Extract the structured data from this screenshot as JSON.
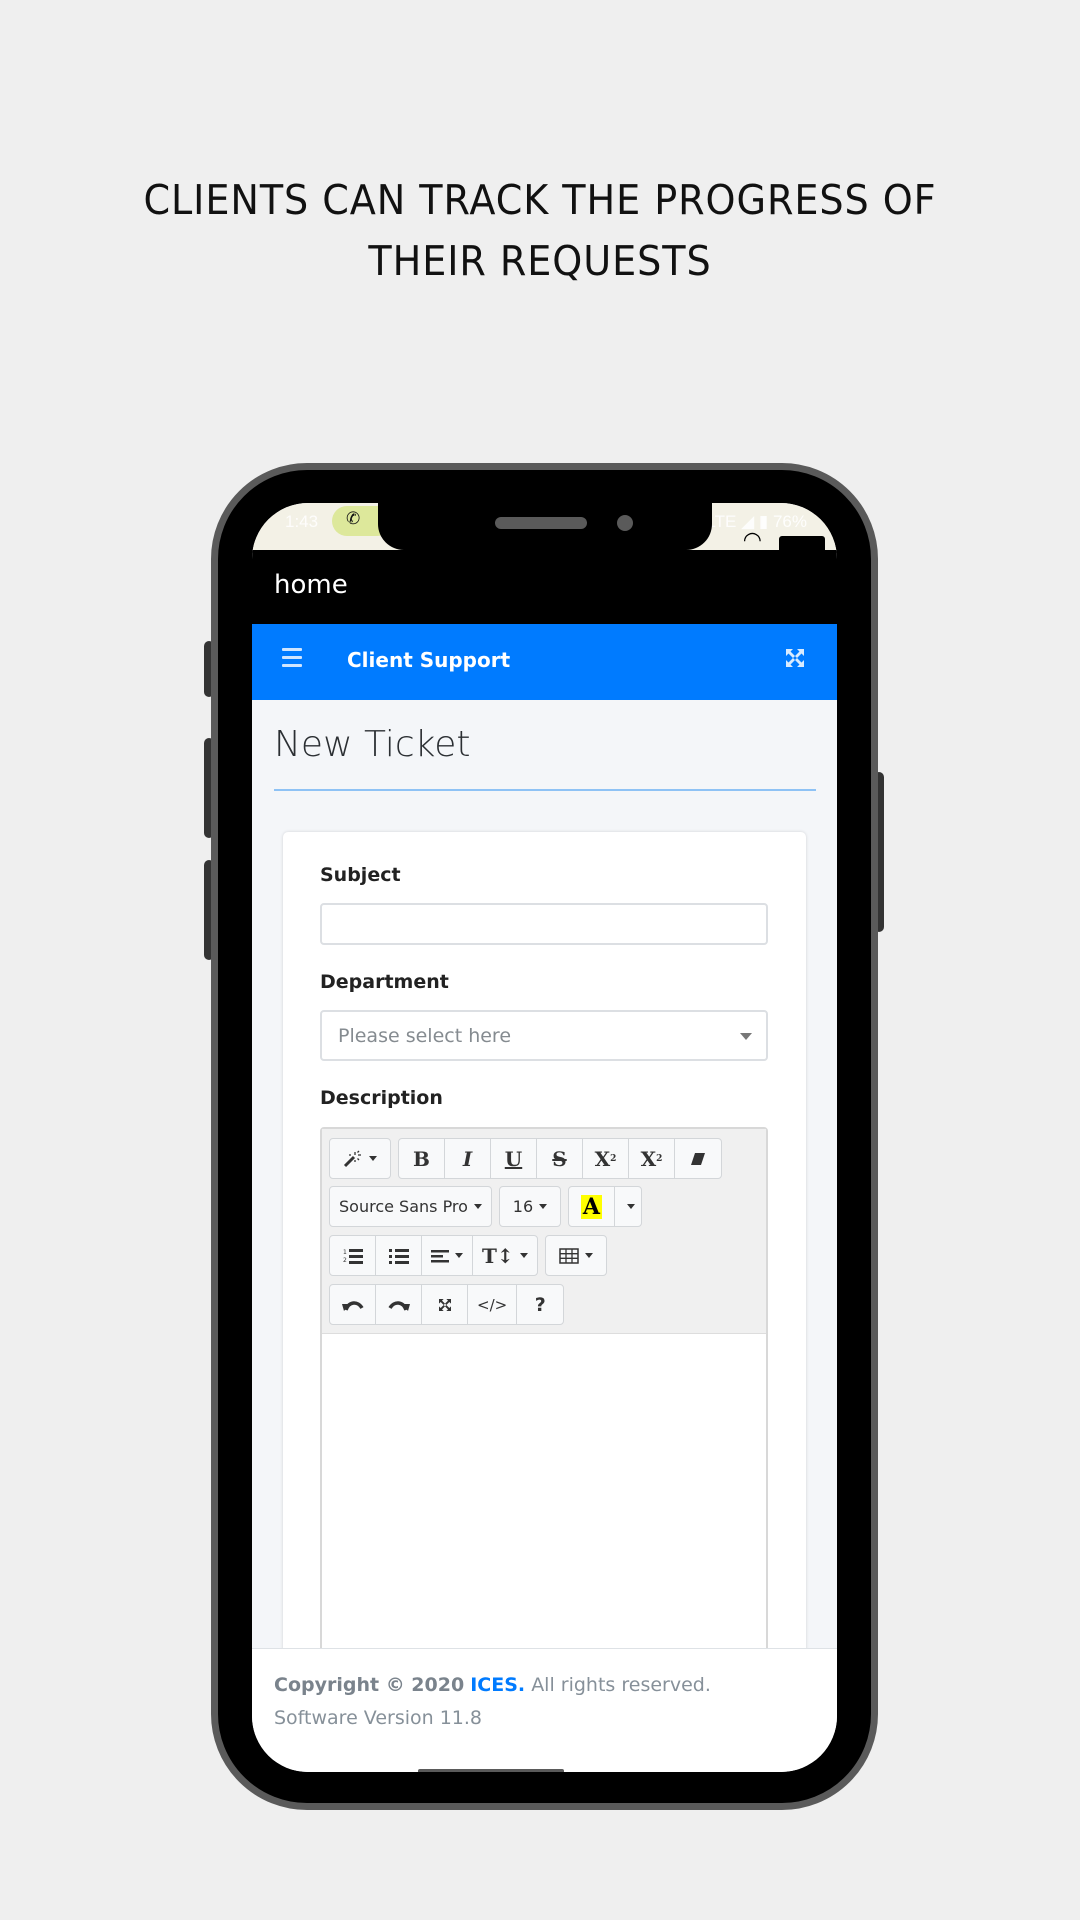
{
  "headline": {
    "line1": "CLIENTS CAN TRACK THE PROGRESS OF",
    "line2": "THEIR REQUESTS"
  },
  "statusbar": {
    "time": "1:43",
    "call_icon": "phone-icon",
    "network": "LTE",
    "battery": "76%"
  },
  "appbar": {
    "title": "home"
  },
  "navbar": {
    "menu_icon": "hamburger-menu-icon",
    "title": "Client Support",
    "expand_icon": "fullscreen-icon"
  },
  "page": {
    "title": "New Ticket"
  },
  "form": {
    "subject": {
      "label": "Subject",
      "value": "",
      "placeholder": ""
    },
    "department": {
      "label": "Department",
      "placeholder": "Please select here"
    },
    "description": {
      "label": "Description"
    }
  },
  "editor_toolbar": {
    "row1": [
      {
        "icon": "magic-wand-style-icon",
        "glyph": "✨"
      },
      {
        "icon": "bold-icon",
        "glyph": "B"
      },
      {
        "icon": "italic-icon",
        "glyph": "I"
      },
      {
        "icon": "underline-icon",
        "glyph": "U"
      },
      {
        "icon": "strikethrough-icon",
        "glyph": "S"
      },
      {
        "icon": "superscript-icon",
        "glyph": "X²"
      },
      {
        "icon": "subscript-icon",
        "glyph": "X₂"
      },
      {
        "icon": "eraser-icon",
        "glyph": "⌫"
      }
    ],
    "font_name": "Source Sans Pro",
    "font_size": "16",
    "color_glyph": "A",
    "row3": [
      {
        "icon": "ordered-list-icon"
      },
      {
        "icon": "unordered-list-icon"
      },
      {
        "icon": "align-icon"
      },
      {
        "icon": "line-height-icon",
        "glyph": "T↕"
      },
      {
        "icon": "table-icon"
      }
    ],
    "row4": [
      {
        "icon": "undo-icon",
        "glyph": "↶"
      },
      {
        "icon": "redo-icon",
        "glyph": "↷"
      },
      {
        "icon": "fullscreen-icon"
      },
      {
        "icon": "code-view-icon",
        "glyph": "</>"
      },
      {
        "icon": "help-icon",
        "glyph": "?"
      }
    ]
  },
  "footer": {
    "copyright": "Copyright © 2020",
    "company": "ICES.",
    "rights": "All rights reserved. Software Version 11.8"
  },
  "colors": {
    "brand_blue": "#007bff",
    "app_bar": "#000000",
    "content_bg": "#f4f6f9",
    "highlight_yellow": "#ffff00"
  }
}
